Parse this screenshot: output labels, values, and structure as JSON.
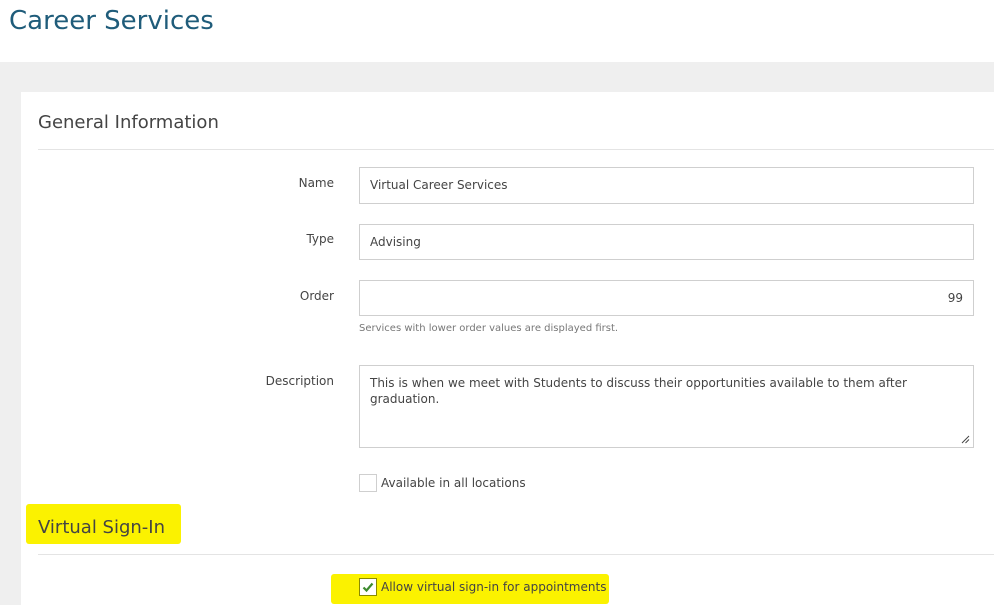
{
  "page": {
    "title": "Career Services"
  },
  "general_information": {
    "heading": "General Information",
    "fields": {
      "name": {
        "label": "Name",
        "value": "Virtual Career Services"
      },
      "type": {
        "label": "Type",
        "value": "Advising"
      },
      "order": {
        "label": "Order",
        "value": "99",
        "help": "Services with lower order values are displayed first."
      },
      "description": {
        "label": "Description",
        "value": "This is when we meet with Students to discuss their opportunities available to them after graduation."
      }
    },
    "available_all_locations": {
      "label": "Available in all locations",
      "checked": false
    }
  },
  "virtual_sign_in": {
    "heading": "Virtual Sign-In",
    "allow_virtual": {
      "label": "Allow virtual sign-in for appointments",
      "checked": true
    }
  },
  "colors": {
    "title": "#1f5c7a",
    "highlight": "#fbf200",
    "check": "#3c8a2e",
    "background_band": "#efefef"
  },
  "icons": {
    "checkmark": "check-icon",
    "resize": "resize-grip-icon"
  }
}
